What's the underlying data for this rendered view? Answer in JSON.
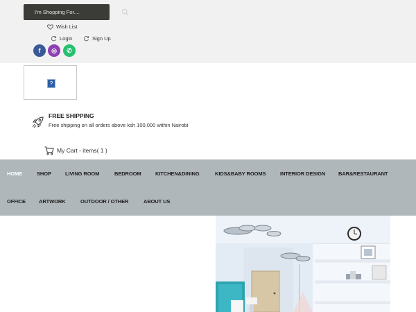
{
  "search": {
    "placeholder": "I'm Shopping For....",
    "icon": "search-icon"
  },
  "header_links": {
    "wishlist": "Wish List",
    "login": "Login",
    "signup": "Sign Up"
  },
  "social": [
    {
      "name": "facebook",
      "glyph": "f",
      "color": "#3b5998"
    },
    {
      "name": "instagram",
      "glyph": "◎",
      "color": "#8e3fb0"
    },
    {
      "name": "whatsapp",
      "glyph": "✆",
      "color": "#25c16f"
    }
  ],
  "logo": {
    "glyph": "?"
  },
  "shipping": {
    "title": "FREE SHIPPING",
    "text": "Free shipping on all orders above ksh 100,000 within Nairobi"
  },
  "cart": {
    "label": "My Cart - items( 1 )"
  },
  "nav": {
    "row1": [
      "HOME",
      "SHOP",
      "LIVING ROOM",
      "BEDROOM",
      "KITCHEN&DINING",
      "KIDS&BABY ROOMS",
      "INTERIOR DESIGN",
      "BAR&RESTAURANT"
    ],
    "row2": [
      "OFFICE",
      "ARTWORK",
      "OUTDOOR / OTHER",
      "ABOUT US"
    ],
    "active": "HOME"
  },
  "colors": {
    "topbar": "#f1f1f1",
    "search_bg": "#3b3b37",
    "nav_bg": "#b0b7bb",
    "nav_active_text": "#ffffff"
  }
}
